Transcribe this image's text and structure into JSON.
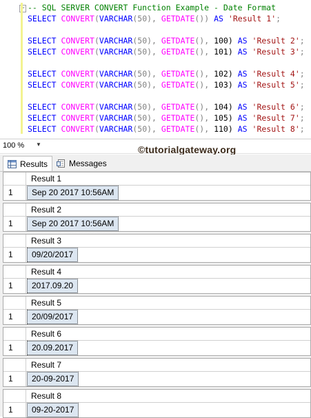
{
  "editor": {
    "fold_symbol": "−",
    "comment": "-- SQL SERVER CONVERT Function Example - Date Format",
    "lines": [
      {
        "select": "SELECT",
        "convert": "CONVERT",
        "open": "(",
        "varchar": "VARCHAR",
        "len": "(50), ",
        "getdate": "GETDATE",
        "args": "())",
        "style": "",
        "as": "AS",
        "alias": "'Result 1'",
        "end": ";"
      },
      {
        "select": "SELECT",
        "convert": "CONVERT",
        "open": "(",
        "varchar": "VARCHAR",
        "len": "(50), ",
        "getdate": "GETDATE",
        "args": "(), ",
        "style": "100)",
        "as": "AS",
        "alias": "'Result 2'",
        "end": ";"
      },
      {
        "select": "SELECT",
        "convert": "CONVERT",
        "open": "(",
        "varchar": "VARCHAR",
        "len": "(50), ",
        "getdate": "GETDATE",
        "args": "(), ",
        "style": "101)",
        "as": "AS",
        "alias": "'Result 3'",
        "end": ";"
      },
      {
        "select": "SELECT",
        "convert": "CONVERT",
        "open": "(",
        "varchar": "VARCHAR",
        "len": "(50), ",
        "getdate": "GETDATE",
        "args": "(), ",
        "style": "102)",
        "as": "AS",
        "alias": "'Result 4'",
        "end": ";"
      },
      {
        "select": "SELECT",
        "convert": "CONVERT",
        "open": "(",
        "varchar": "VARCHAR",
        "len": "(50), ",
        "getdate": "GETDATE",
        "args": "(), ",
        "style": "103)",
        "as": "AS",
        "alias": "'Result 5'",
        "end": ";"
      },
      {
        "select": "SELECT",
        "convert": "CONVERT",
        "open": "(",
        "varchar": "VARCHAR",
        "len": "(50), ",
        "getdate": "GETDATE",
        "args": "(), ",
        "style": "104)",
        "as": "AS",
        "alias": "'Result 6'",
        "end": ";"
      },
      {
        "select": "SELECT",
        "convert": "CONVERT",
        "open": "(",
        "varchar": "VARCHAR",
        "len": "(50), ",
        "getdate": "GETDATE",
        "args": "(), ",
        "style": "105)",
        "as": "AS",
        "alias": "'Result 7'",
        "end": ";"
      },
      {
        "select": "SELECT",
        "convert": "CONVERT",
        "open": "(",
        "varchar": "VARCHAR",
        "len": "(50), ",
        "getdate": "GETDATE",
        "args": "(), ",
        "style": "110)",
        "as": "AS",
        "alias": "'Result 8'",
        "end": ";"
      }
    ]
  },
  "zoom": {
    "value": "100 %"
  },
  "watermark": "©tutorialgateway.org",
  "tabs": [
    {
      "label": "Results",
      "icon": "grid-icon"
    },
    {
      "label": "Messages",
      "icon": "messages-icon"
    }
  ],
  "results": [
    {
      "header": "Result 1",
      "row": "1",
      "value": "Sep 20 2017 10:56AM"
    },
    {
      "header": "Result 2",
      "row": "1",
      "value": "Sep 20 2017 10:56AM"
    },
    {
      "header": "Result 3",
      "row": "1",
      "value": "09/20/2017"
    },
    {
      "header": "Result 4",
      "row": "1",
      "value": "2017.09.20"
    },
    {
      "header": "Result 5",
      "row": "1",
      "value": "20/09/2017"
    },
    {
      "header": "Result 6",
      "row": "1",
      "value": "20.09.2017"
    },
    {
      "header": "Result 7",
      "row": "1",
      "value": "20-09-2017"
    },
    {
      "header": "Result 8",
      "row": "1",
      "value": "09-20-2017"
    }
  ]
}
